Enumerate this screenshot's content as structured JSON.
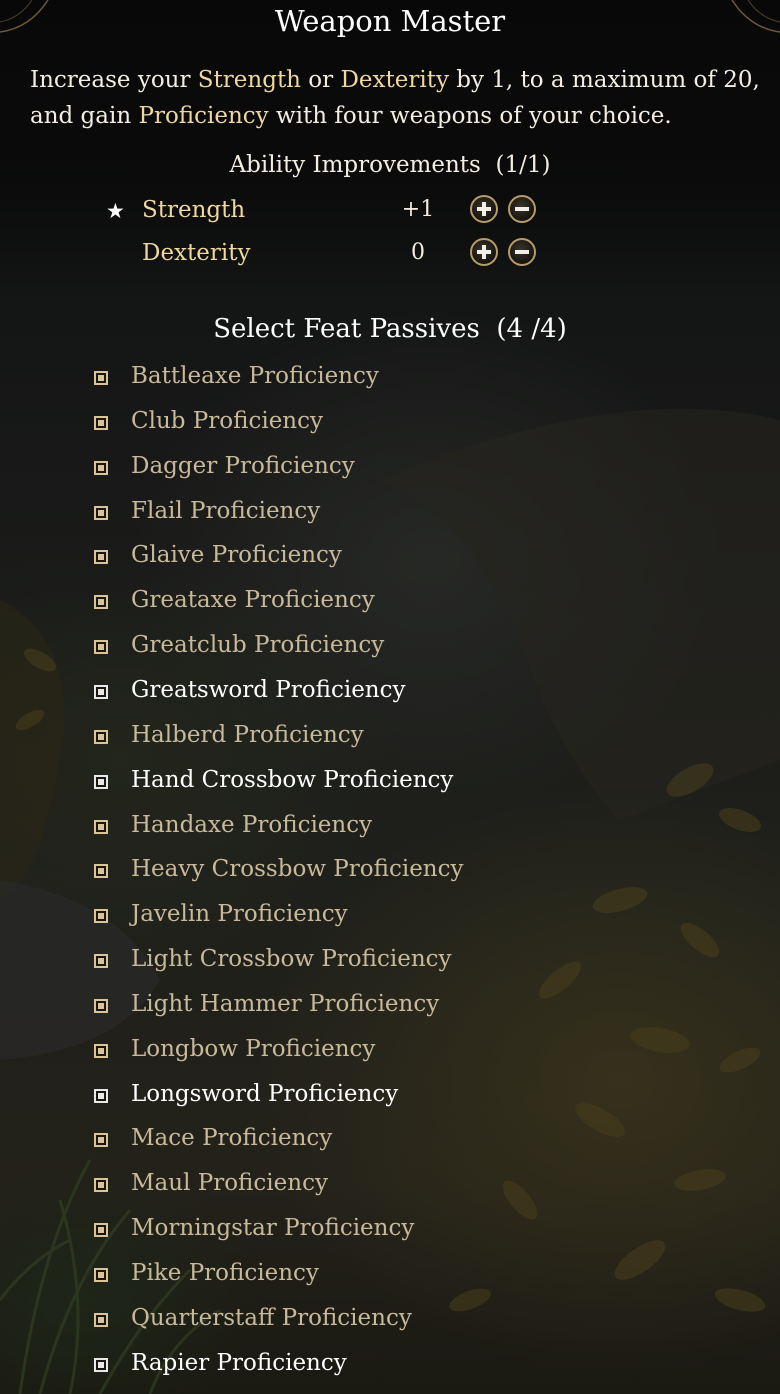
{
  "feat": {
    "title": "Weapon Master",
    "description": {
      "part1": "Increase your ",
      "strength": "Strength",
      "part2": " or ",
      "dexterity": "Dexterity",
      "part3": " by 1, to a maximum of 20, and gain ",
      "proficiency": "Proficiency",
      "part4": " with four weapons of your choice."
    }
  },
  "ability_improvements": {
    "heading": "Ability Improvements",
    "count": "(1/1)",
    "rows": [
      {
        "star": "★",
        "name": "Strength",
        "value": "+1"
      },
      {
        "star": "",
        "name": "Dexterity",
        "value": "0"
      }
    ]
  },
  "passives": {
    "heading": "Select Feat Passives",
    "count": "(4 /4)",
    "items": [
      {
        "label": "Battleaxe Proficiency",
        "selected": false
      },
      {
        "label": "Club Proficiency",
        "selected": false
      },
      {
        "label": "Dagger Proficiency",
        "selected": false
      },
      {
        "label": "Flail Proficiency",
        "selected": false
      },
      {
        "label": "Glaive Proficiency",
        "selected": false
      },
      {
        "label": "Greataxe Proficiency",
        "selected": false
      },
      {
        "label": "Greatclub Proficiency",
        "selected": false
      },
      {
        "label": "Greatsword Proficiency",
        "selected": true
      },
      {
        "label": "Halberd Proficiency",
        "selected": false
      },
      {
        "label": "Hand Crossbow Proficiency",
        "selected": true
      },
      {
        "label": "Handaxe Proficiency",
        "selected": false
      },
      {
        "label": "Heavy Crossbow Proficiency",
        "selected": false
      },
      {
        "label": "Javelin Proficiency",
        "selected": false
      },
      {
        "label": "Light Crossbow Proficiency",
        "selected": false
      },
      {
        "label": "Light Hammer Proficiency",
        "selected": false
      },
      {
        "label": "Longbow Proficiency",
        "selected": false
      },
      {
        "label": "Longsword Proficiency",
        "selected": true
      },
      {
        "label": "Mace Proficiency",
        "selected": false
      },
      {
        "label": "Maul Proficiency",
        "selected": false
      },
      {
        "label": "Morningstar Proficiency",
        "selected": false
      },
      {
        "label": "Pike Proficiency",
        "selected": false
      },
      {
        "label": "Quarterstaff Proficiency",
        "selected": false
      },
      {
        "label": "Rapier Proficiency",
        "selected": true
      }
    ]
  },
  "colors": {
    "highlight": "#eed7a0",
    "selected_text": "#ffffff",
    "unselected_text": "#c9b99b",
    "button_ring": "#b79b6a"
  },
  "icons": {
    "plus": "plus-icon",
    "minus": "minus-icon",
    "star": "star-icon",
    "checkbox": "checkbox-icon"
  }
}
